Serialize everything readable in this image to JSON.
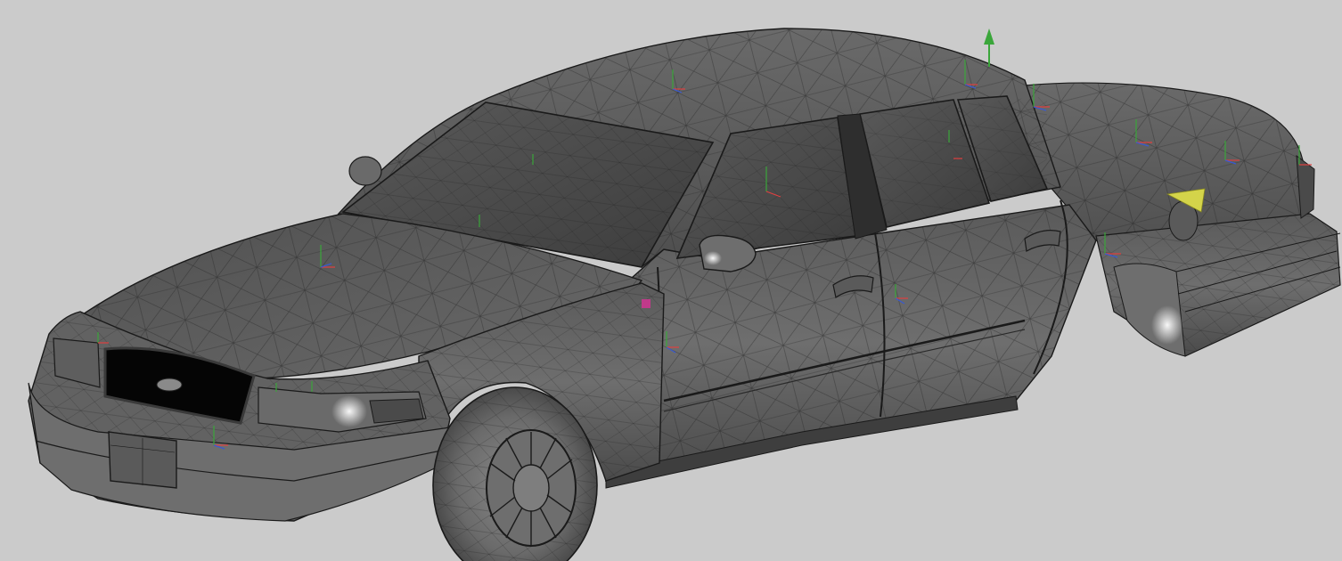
{
  "viewport": {
    "background": "#cbcbcb",
    "body_color": "#5e5e5e",
    "body_light": "#8a8a8a",
    "body_dark": "#3a3a3a",
    "wire_color": "#1f1f1f",
    "highlight": "#f2f2f2",
    "glass": "#4a4a4a",
    "grille": "#050505",
    "selected_face": "#d4d44a",
    "selected_vertex": "#c03a8a",
    "gizmo_colors": {
      "x": "#e04040",
      "y": "#3aa63a",
      "z": "#3a5ad0"
    }
  },
  "model": {
    "object": "sedan-mesh",
    "display_mode": "shaded-wireframe",
    "gizmo": "move-arrow-y"
  }
}
